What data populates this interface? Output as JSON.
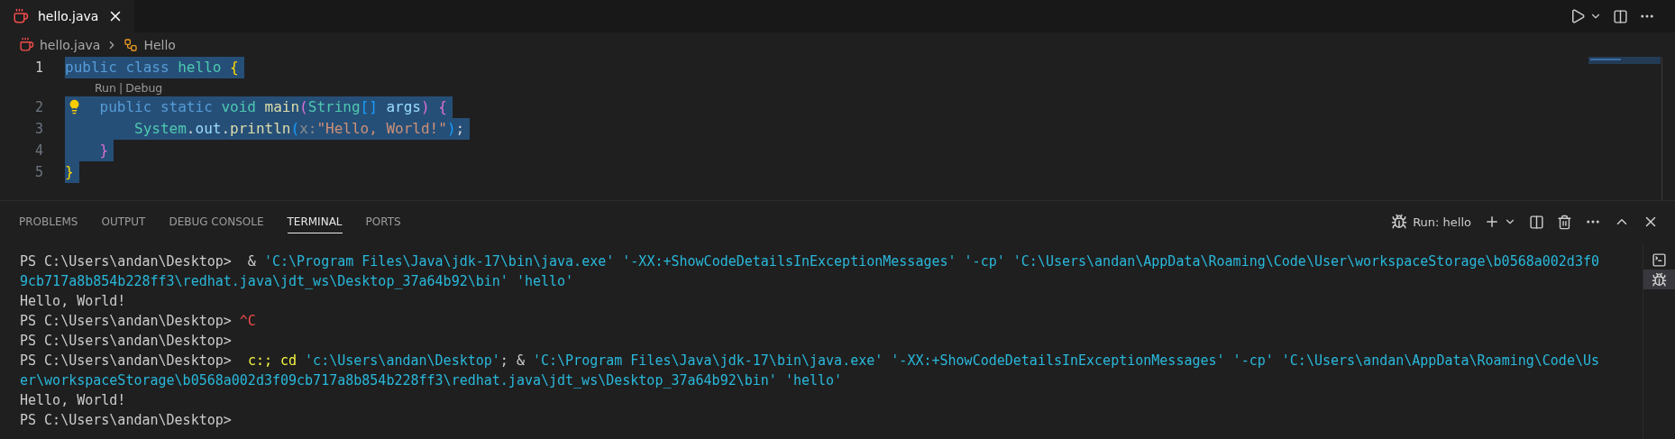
{
  "editor": {
    "tabs": [
      {
        "label": "hello.java",
        "selected": true
      }
    ],
    "breadcrumb": [
      "hello.java",
      "Hello"
    ],
    "lines": [
      {
        "kind": "code",
        "number": "1",
        "selected": true,
        "lightbulb": false,
        "tokens": [
          {
            "text": "public class",
            "kind": "keyword"
          },
          {
            "text": " hello",
            "kind": "type"
          },
          {
            "text": " {",
            "kind": "brace1"
          }
        ]
      },
      {
        "kind": "codelens",
        "actions": [
          "Run",
          "Debug"
        ],
        "separator": "|"
      },
      {
        "kind": "code",
        "number": "2",
        "selected": true,
        "lightbulb": true,
        "tokens": [
          {
            "text": "    public static",
            "kind": "keyword"
          },
          {
            "text": " void",
            "kind": "type"
          },
          {
            "text": " main",
            "kind": "function"
          },
          {
            "text": "(",
            "kind": "brace2"
          },
          {
            "text": "String",
            "kind": "type"
          },
          {
            "text": "[]",
            "kind": "brace3"
          },
          {
            "text": " args",
            "kind": "variable"
          },
          {
            "text": ")",
            "kind": "brace2"
          },
          {
            "text": " {",
            "kind": "brace2"
          }
        ]
      },
      {
        "kind": "code",
        "number": "3",
        "selected": true,
        "lightbulb": false,
        "tokens": [
          {
            "text": "        System",
            "kind": "type"
          },
          {
            "text": ".",
            "kind": "plain"
          },
          {
            "text": "out",
            "kind": "variable"
          },
          {
            "text": ".",
            "kind": "plain"
          },
          {
            "text": "println",
            "kind": "function"
          },
          {
            "text": "(",
            "kind": "brace3"
          },
          {
            "text": "x:",
            "kind": "hint"
          },
          {
            "text": "\"Hello, World!\"",
            "kind": "string"
          },
          {
            "text": ")",
            "kind": "brace3"
          },
          {
            "text": ";",
            "kind": "plain"
          }
        ]
      },
      {
        "kind": "code",
        "number": "4",
        "selected": true,
        "lightbulb": false,
        "tokens": [
          {
            "text": "    }",
            "kind": "brace2"
          }
        ]
      },
      {
        "kind": "code",
        "number": "5",
        "selected": true,
        "lightbulb": false,
        "tokens": [
          {
            "text": "}",
            "kind": "brace1"
          }
        ]
      }
    ]
  },
  "panel": {
    "tabs": [
      {
        "label": "PROBLEMS",
        "selected": false
      },
      {
        "label": "OUTPUT",
        "selected": false
      },
      {
        "label": "DEBUG CONSOLE",
        "selected": false
      },
      {
        "label": "TERMINAL",
        "selected": true
      },
      {
        "label": "PORTS",
        "selected": false
      }
    ],
    "run_label": "Run: hello",
    "terminal_lines": [
      {
        "segments": [
          {
            "text": "PS C:\\Users\\andan\\Desktop>  & ",
            "kind": "plain"
          },
          {
            "text": "'C:\\Program Files\\Java\\jdk-17\\bin\\java.exe' '-XX:+ShowCodeDetailsInExceptionMessages' '-cp' 'C:\\Users\\andan\\AppData\\Roaming\\Code\\User\\workspaceStorage\\b0568a002d3f0",
            "kind": "string"
          }
        ]
      },
      {
        "segments": [
          {
            "text": "9cb717a8b854b228ff3\\redhat.java\\jdt_ws\\Desktop_37a64b92\\bin' 'hello'",
            "kind": "string"
          }
        ]
      },
      {
        "segments": [
          {
            "text": "Hello, World!",
            "kind": "plain"
          }
        ]
      },
      {
        "segments": [
          {
            "text": "PS C:\\Users\\andan\\Desktop> ",
            "kind": "plain"
          },
          {
            "text": "^C",
            "kind": "error"
          }
        ]
      },
      {
        "segments": [
          {
            "text": "PS C:\\Users\\andan\\Desktop>",
            "kind": "plain"
          }
        ]
      },
      {
        "segments": [
          {
            "text": "PS C:\\Users\\andan\\Desktop>  ",
            "kind": "plain"
          },
          {
            "text": "c:; cd",
            "kind": "command"
          },
          {
            "text": " 'c:\\Users\\andan\\Desktop'",
            "kind": "string"
          },
          {
            "text": "; & ",
            "kind": "plain"
          },
          {
            "text": "'C:\\Program Files\\Java\\jdk-17\\bin\\java.exe' '-XX:+ShowCodeDetailsInExceptionMessages' '-cp' 'C:\\Users\\andan\\AppData\\Roaming\\Code\\Us",
            "kind": "string"
          }
        ]
      },
      {
        "segments": [
          {
            "text": "er\\workspaceStorage\\b0568a002d3f09cb717a8b854b228ff3\\redhat.java\\jdt_ws\\Desktop_37a64b92\\bin' 'hello'",
            "kind": "string"
          }
        ]
      },
      {
        "segments": [
          {
            "text": "Hello, World!",
            "kind": "plain"
          }
        ]
      },
      {
        "segments": [
          {
            "text": "PS C:\\Users\\andan\\Desktop>",
            "kind": "plain"
          }
        ]
      }
    ],
    "side_tabs": [
      {
        "kind": "terminal",
        "selected": false
      },
      {
        "kind": "debug",
        "selected": true
      }
    ]
  }
}
